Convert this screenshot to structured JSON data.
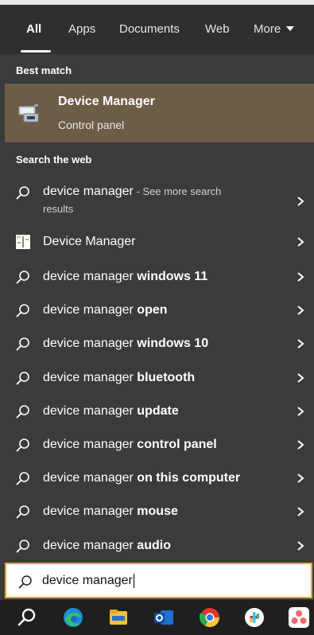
{
  "tabs": {
    "all": "All",
    "apps": "Apps",
    "documents": "Documents",
    "web": "Web",
    "more": "More"
  },
  "best_match": {
    "heading": "Best match",
    "title": "Device Manager",
    "subtitle": "Control panel"
  },
  "search_web": {
    "heading": "Search the web",
    "first": {
      "query": "device manager",
      "more": " - See more search",
      "results": "results"
    },
    "app_result": "Device Manager",
    "suggestions": [
      {
        "prefix": "device manager ",
        "bold": "windows 11"
      },
      {
        "prefix": "device manager ",
        "bold": "open"
      },
      {
        "prefix": "device manager ",
        "bold": "windows 10"
      },
      {
        "prefix": "device manager ",
        "bold": "bluetooth"
      },
      {
        "prefix": "device manager ",
        "bold": "update"
      },
      {
        "prefix": "device manager ",
        "bold": "control panel"
      },
      {
        "prefix": "device manager ",
        "bold": "on this computer"
      },
      {
        "prefix": "device manager ",
        "bold": "mouse"
      },
      {
        "prefix": "device manager ",
        "bold": "audio"
      }
    ]
  },
  "search_box": {
    "value": "device manager"
  },
  "taskbar": {
    "icons": [
      "search-icon",
      "edge-icon",
      "file-explorer-icon",
      "outlook-icon",
      "chrome-icon",
      "slack-icon",
      "asana-icon"
    ]
  },
  "colors": {
    "best_match_bg": "#6d5c46",
    "search_border": "#e1a934",
    "panel_bg": "#3b3b3b"
  }
}
